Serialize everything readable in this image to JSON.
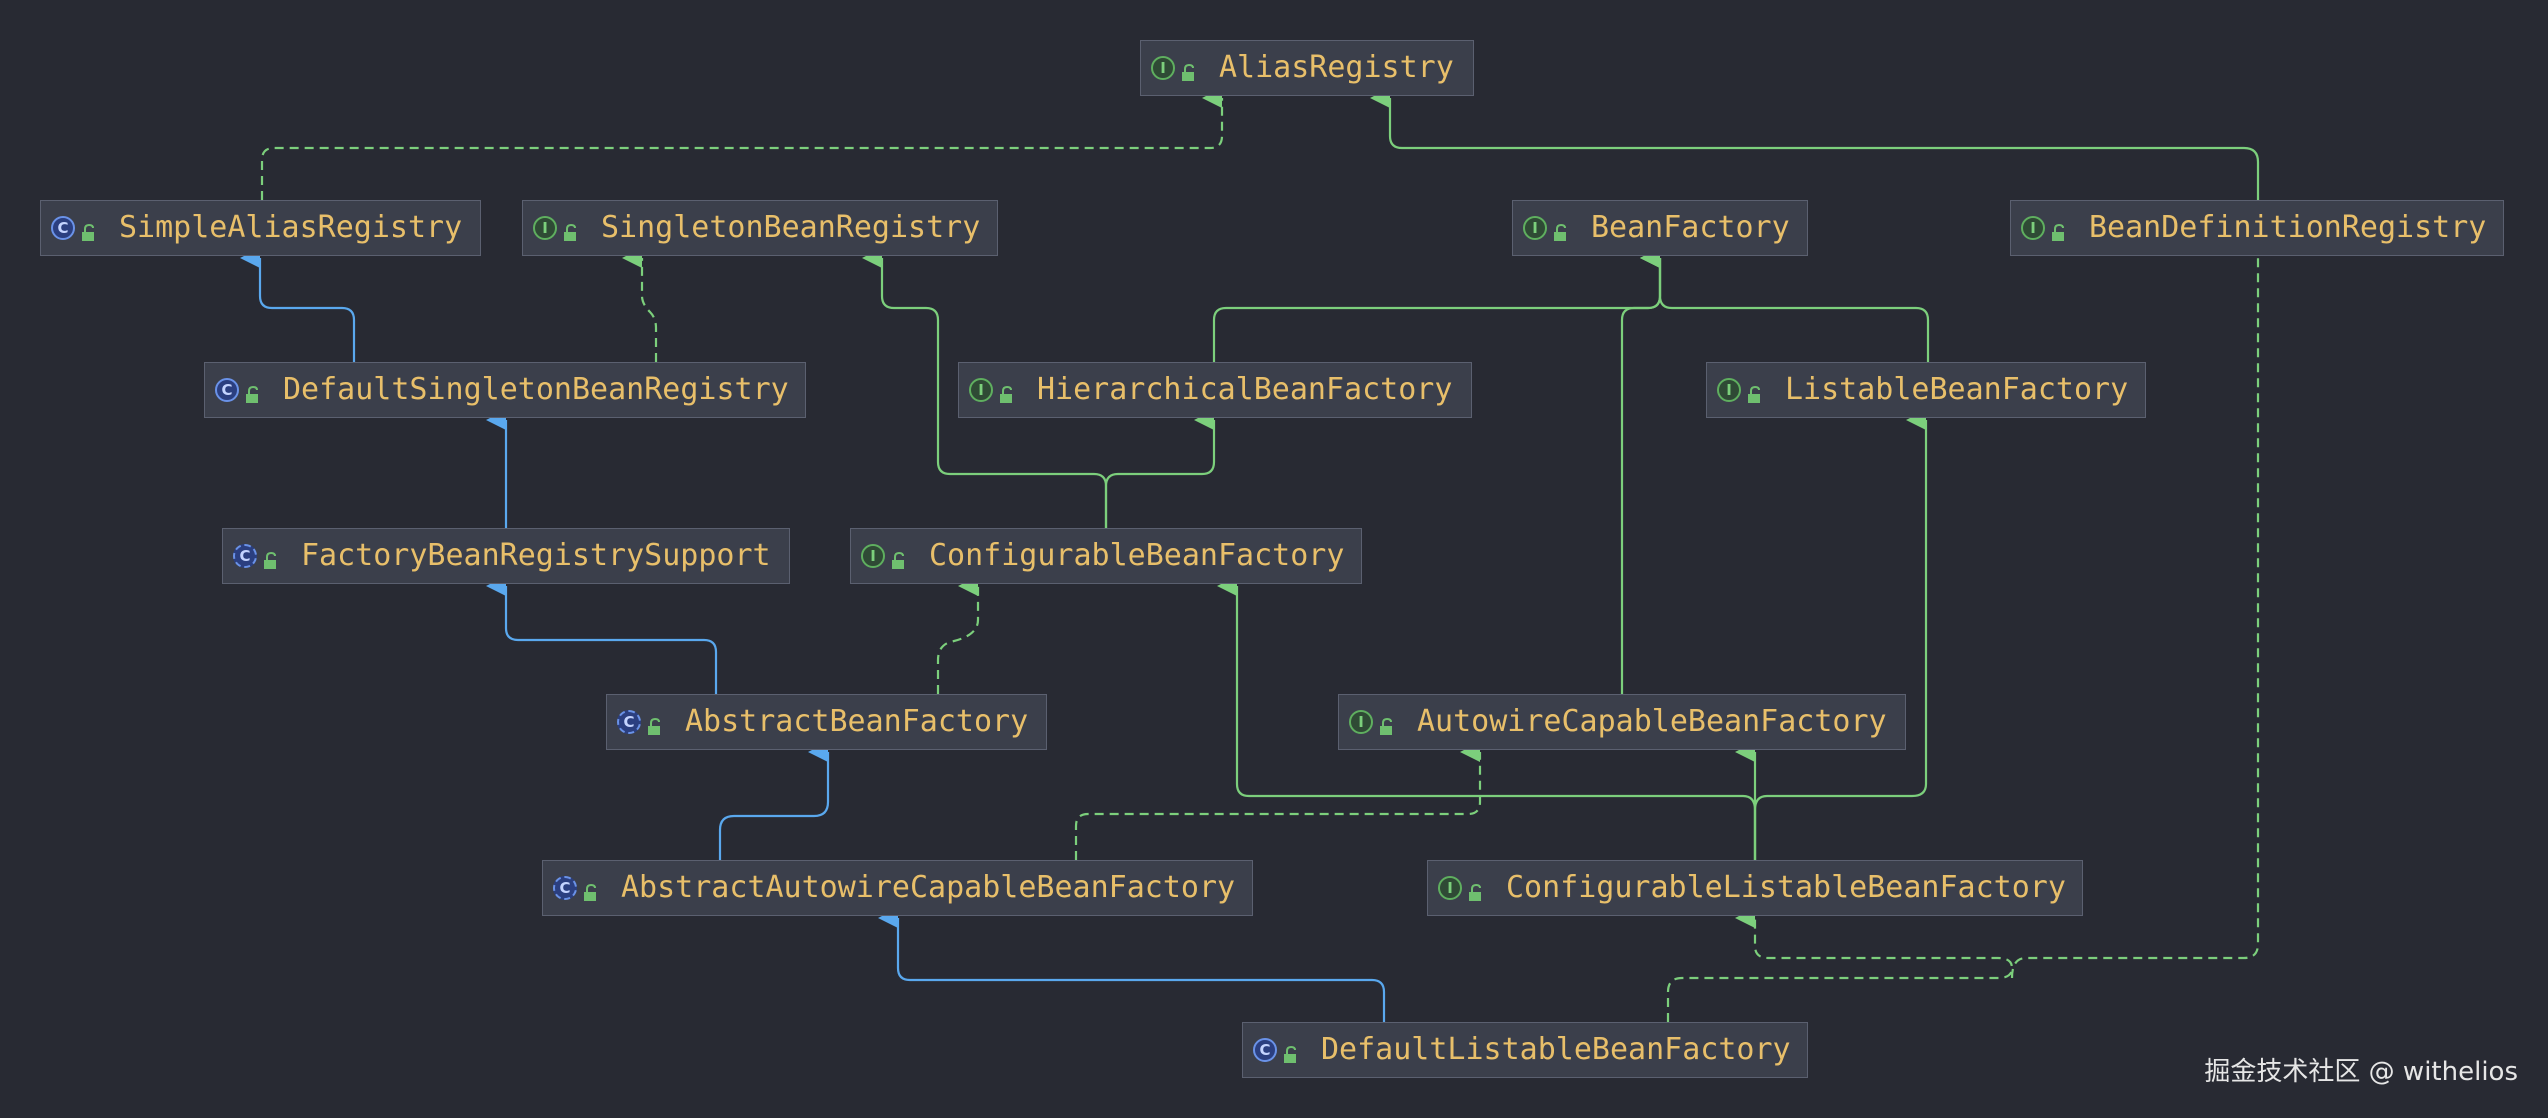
{
  "colors": {
    "background": "#282a33",
    "interface_edge": "#7ccf7c",
    "class_edge": "#5aa8ee",
    "node_text": "#e8bf6a"
  },
  "nodes": [
    {
      "id": "alias-registry",
      "label": "AliasRegistry",
      "kind": "interface",
      "icon": "interface-icon"
    },
    {
      "id": "simple-alias-registry",
      "label": "SimpleAliasRegistry",
      "kind": "class",
      "icon": "class-icon"
    },
    {
      "id": "singleton-bean-registry",
      "label": "SingletonBeanRegistry",
      "kind": "interface",
      "icon": "interface-icon"
    },
    {
      "id": "bean-factory",
      "label": "BeanFactory",
      "kind": "interface",
      "icon": "interface-icon"
    },
    {
      "id": "bean-definition-registry",
      "label": "BeanDefinitionRegistry",
      "kind": "interface",
      "icon": "interface-icon"
    },
    {
      "id": "default-singleton-bean-registry",
      "label": "DefaultSingletonBeanRegistry",
      "kind": "class",
      "icon": "class-icon"
    },
    {
      "id": "hierarchical-bean-factory",
      "label": "HierarchicalBeanFactory",
      "kind": "interface",
      "icon": "interface-icon"
    },
    {
      "id": "listable-bean-factory",
      "label": "ListableBeanFactory",
      "kind": "interface",
      "icon": "interface-icon"
    },
    {
      "id": "factory-bean-registry-support",
      "label": "FactoryBeanRegistrySupport",
      "kind": "abstract-class",
      "icon": "abstract-class-icon"
    },
    {
      "id": "configurable-bean-factory",
      "label": "ConfigurableBeanFactory",
      "kind": "interface",
      "icon": "interface-icon"
    },
    {
      "id": "abstract-bean-factory",
      "label": "AbstractBeanFactory",
      "kind": "abstract-class",
      "icon": "abstract-class-icon"
    },
    {
      "id": "autowire-capable-bean-factory",
      "label": "AutowireCapableBeanFactory",
      "kind": "interface",
      "icon": "interface-icon"
    },
    {
      "id": "abstract-autowire-capable-bean-factory",
      "label": "AbstractAutowireCapableBeanFactory",
      "kind": "abstract-class",
      "icon": "abstract-class-icon"
    },
    {
      "id": "configurable-listable-bean-factory",
      "label": "ConfigurableListableBeanFactory",
      "kind": "interface",
      "icon": "interface-icon"
    },
    {
      "id": "default-listable-bean-factory",
      "label": "DefaultListableBeanFactory",
      "kind": "class",
      "icon": "class-icon"
    }
  ],
  "edges": [
    {
      "from": "simple-alias-registry",
      "to": "alias-registry",
      "type": "implements"
    },
    {
      "from": "bean-definition-registry",
      "to": "alias-registry",
      "type": "extends-interface"
    },
    {
      "from": "default-singleton-bean-registry",
      "to": "simple-alias-registry",
      "type": "extends"
    },
    {
      "from": "default-singleton-bean-registry",
      "to": "singleton-bean-registry",
      "type": "implements"
    },
    {
      "from": "hierarchical-bean-factory",
      "to": "bean-factory",
      "type": "extends-interface"
    },
    {
      "from": "listable-bean-factory",
      "to": "bean-factory",
      "type": "extends-interface"
    },
    {
      "from": "autowire-capable-bean-factory",
      "to": "bean-factory",
      "type": "extends-interface"
    },
    {
      "from": "factory-bean-registry-support",
      "to": "default-singleton-bean-registry",
      "type": "extends"
    },
    {
      "from": "configurable-bean-factory",
      "to": "hierarchical-bean-factory",
      "type": "extends-interface"
    },
    {
      "from": "configurable-bean-factory",
      "to": "singleton-bean-registry",
      "type": "extends-interface"
    },
    {
      "from": "abstract-bean-factory",
      "to": "factory-bean-registry-support",
      "type": "extends"
    },
    {
      "from": "abstract-bean-factory",
      "to": "configurable-bean-factory",
      "type": "implements"
    },
    {
      "from": "abstract-autowire-capable-bean-factory",
      "to": "abstract-bean-factory",
      "type": "extends"
    },
    {
      "from": "abstract-autowire-capable-bean-factory",
      "to": "autowire-capable-bean-factory",
      "type": "implements"
    },
    {
      "from": "configurable-listable-bean-factory",
      "to": "autowire-capable-bean-factory",
      "type": "extends-interface"
    },
    {
      "from": "configurable-listable-bean-factory",
      "to": "configurable-bean-factory",
      "type": "extends-interface"
    },
    {
      "from": "configurable-listable-bean-factory",
      "to": "listable-bean-factory",
      "type": "extends-interface"
    },
    {
      "from": "default-listable-bean-factory",
      "to": "abstract-autowire-capable-bean-factory",
      "type": "extends"
    },
    {
      "from": "default-listable-bean-factory",
      "to": "configurable-listable-bean-factory",
      "type": "implements"
    },
    {
      "from": "default-listable-bean-factory",
      "to": "bean-definition-registry",
      "type": "implements"
    }
  ],
  "watermark": "掘金技术社区 @ withelios"
}
